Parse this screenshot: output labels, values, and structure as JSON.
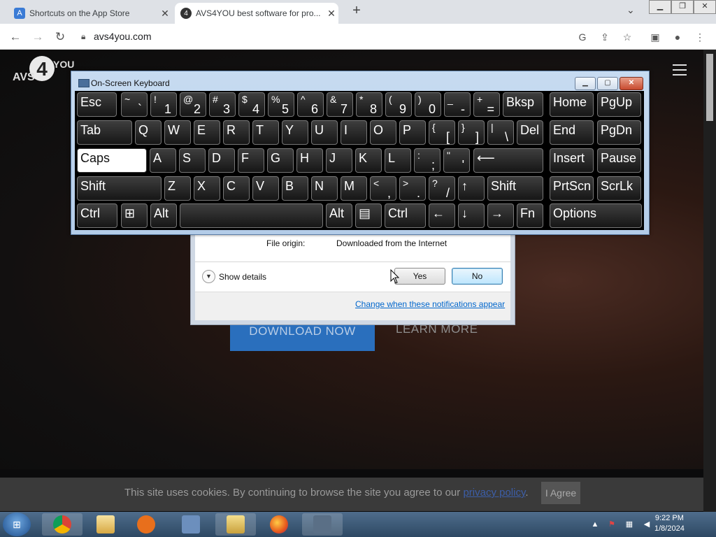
{
  "browser": {
    "tabs": [
      {
        "title": "Shortcuts on the App Store",
        "favicon": "app-store-icon",
        "active": false
      },
      {
        "title": "AVS4YOU best software for pro...",
        "favicon": "avs4you-icon",
        "active": true
      }
    ],
    "url": "avs4you.com"
  },
  "site": {
    "logo_number": "4",
    "logo_you": "YOU",
    "logo_avs": "AVS",
    "download_label": "DOWNLOAD NOW",
    "learn_more_label": "LEARN MORE",
    "cookie_text_before": "This site uses cookies. By continuing to browse the site you agree to our ",
    "cookie_link": "privacy policy",
    "cookie_text_after": ".",
    "agree_label": "I Agree"
  },
  "uac": {
    "origin_label": "File origin:",
    "origin_value": "Downloaded from the Internet",
    "show_details": "Show details",
    "yes_label": "Yes",
    "no_label": "No",
    "change_link": "Change when these notifications appear"
  },
  "osk": {
    "title": "On-Screen Keyboard",
    "rows": [
      [
        {
          "main": "Esc"
        },
        {
          "top": "~",
          "bottom": "`"
        },
        {
          "top": "!",
          "bottom": "1"
        },
        {
          "top": "@",
          "bottom": "2"
        },
        {
          "top": "#",
          "bottom": "3"
        },
        {
          "top": "$",
          "bottom": "4"
        },
        {
          "top": "%",
          "bottom": "5"
        },
        {
          "top": "^",
          "bottom": "6"
        },
        {
          "top": "&",
          "bottom": "7"
        },
        {
          "top": "*",
          "bottom": "8"
        },
        {
          "top": "(",
          "bottom": "9"
        },
        {
          "top": ")",
          "bottom": "0"
        },
        {
          "top": "_",
          "bottom": "-"
        },
        {
          "top": "+",
          "bottom": "="
        },
        {
          "main": "Bksp"
        },
        {
          "main": "Home"
        },
        {
          "main": "PgUp"
        }
      ],
      [
        {
          "main": "Tab"
        },
        {
          "main": "Q"
        },
        {
          "main": "W"
        },
        {
          "main": "E"
        },
        {
          "main": "R"
        },
        {
          "main": "T"
        },
        {
          "main": "Y"
        },
        {
          "main": "U"
        },
        {
          "main": "I"
        },
        {
          "main": "O"
        },
        {
          "main": "P"
        },
        {
          "top": "{",
          "bottom": "["
        },
        {
          "top": "}",
          "bottom": "]"
        },
        {
          "top": "|",
          "bottom": "\\"
        },
        {
          "main": "Del"
        },
        {
          "main": "End"
        },
        {
          "main": "PgDn"
        }
      ],
      [
        {
          "main": "Caps",
          "active": true
        },
        {
          "main": "A"
        },
        {
          "main": "S"
        },
        {
          "main": "D"
        },
        {
          "main": "F"
        },
        {
          "main": "G"
        },
        {
          "main": "H"
        },
        {
          "main": "J"
        },
        {
          "main": "K"
        },
        {
          "main": "L"
        },
        {
          "top": ":",
          "bottom": ";"
        },
        {
          "top": "\"",
          "bottom": "'"
        },
        {
          "main": "⟵"
        },
        {
          "main": "Insert"
        },
        {
          "main": "Pause"
        }
      ],
      [
        {
          "main": "Shift"
        },
        {
          "main": "Z"
        },
        {
          "main": "X"
        },
        {
          "main": "C"
        },
        {
          "main": "V"
        },
        {
          "main": "B"
        },
        {
          "main": "N"
        },
        {
          "main": "M"
        },
        {
          "top": "<",
          "bottom": ","
        },
        {
          "top": ">",
          "bottom": "."
        },
        {
          "top": "?",
          "bottom": "/"
        },
        {
          "main": "↑"
        },
        {
          "main": "Shift"
        },
        {
          "main": "PrtScn"
        },
        {
          "main": "ScrLk"
        }
      ],
      [
        {
          "main": "Ctrl"
        },
        {
          "main": "⊞"
        },
        {
          "main": "Alt"
        },
        {
          "main": ""
        },
        {
          "main": "Alt"
        },
        {
          "main": "▤"
        },
        {
          "main": "Ctrl"
        },
        {
          "main": "←"
        },
        {
          "main": "↓"
        },
        {
          "main": "→"
        },
        {
          "main": "Fn"
        },
        {
          "main": "Options"
        }
      ]
    ]
  },
  "taskbar": {
    "time": "9:22 PM",
    "date": "1/8/2024",
    "apps": [
      "chrome-icon",
      "file-explorer-icon",
      "media-player-icon",
      "search-tool-icon",
      "folder-icon",
      "firefox-icon",
      "keyboard-icon"
    ]
  }
}
